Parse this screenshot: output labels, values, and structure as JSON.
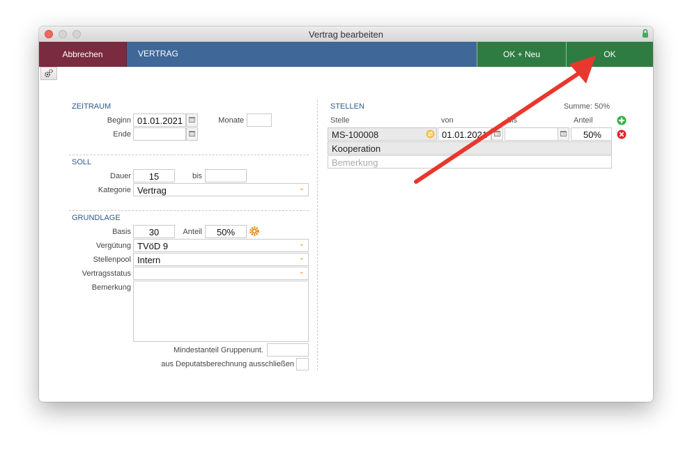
{
  "window": {
    "title": "Vertrag bearbeiten"
  },
  "toolbar": {
    "cancel_label": "Abbrechen",
    "section_title": "VERTRAG",
    "ok_new_label": "OK + Neu",
    "ok_label": "OK"
  },
  "zeitraum": {
    "heading": "ZEITRAUM",
    "beginn_label": "Beginn",
    "beginn_value": "01.01.2021",
    "monate_label": "Monate",
    "monate_value": "",
    "ende_label": "Ende",
    "ende_value": ""
  },
  "soll": {
    "heading": "SOLL",
    "dauer_label": "Dauer",
    "dauer_value": "15",
    "bis_label": "bis",
    "bis_value": "",
    "kategorie_label": "Kategorie",
    "kategorie_value": "Vertrag"
  },
  "grundlage": {
    "heading": "GRUNDLAGE",
    "basis_label": "Basis",
    "basis_value": "30",
    "anteil_label": "Anteil",
    "anteil_value": "50%",
    "verguetung_label": "Vergütung",
    "verguetung_value": "TVöD 9",
    "stellenpool_label": "Stellenpool",
    "stellenpool_value": "Intern",
    "vertragsstatus_label": "Vertragsstatus",
    "vertragsstatus_value": "",
    "bemerkung_label": "Bemerkung",
    "bemerkung_value": "",
    "mindestanteil_label": "Mindestanteil Gruppenunt.",
    "mindestanteil_value": "",
    "deputat_label": "aus Deputatsberechnung ausschließen"
  },
  "stellen": {
    "heading": "STELLEN",
    "summe": "Summe: 50%",
    "col_stelle": "Stelle",
    "col_von": "von",
    "col_bis": "bis",
    "col_anteil": "Anteil",
    "rows": [
      {
        "stelle": "MS-100008",
        "von": "01.01.2021",
        "bis": "",
        "anteil": "50%",
        "kooperation": "Kooperation",
        "bemerkung_placeholder": "Bemerkung"
      }
    ]
  },
  "icons": {
    "settings": "gear-icon",
    "add": "plus-circle-icon",
    "remove": "x-circle-icon",
    "lock": "lock-icon",
    "calendar": "calendar-icon",
    "swap": "swap-icon",
    "anteil_settings": "gear-icon"
  },
  "colors": {
    "cancel": "#7a2b3f",
    "title_bar": "#3f6797",
    "ok": "#2e7c42",
    "section_heading": "#2c5a8e",
    "dropdown_chevron": "#e58e1a",
    "annotation_arrow": "#e8382d"
  }
}
